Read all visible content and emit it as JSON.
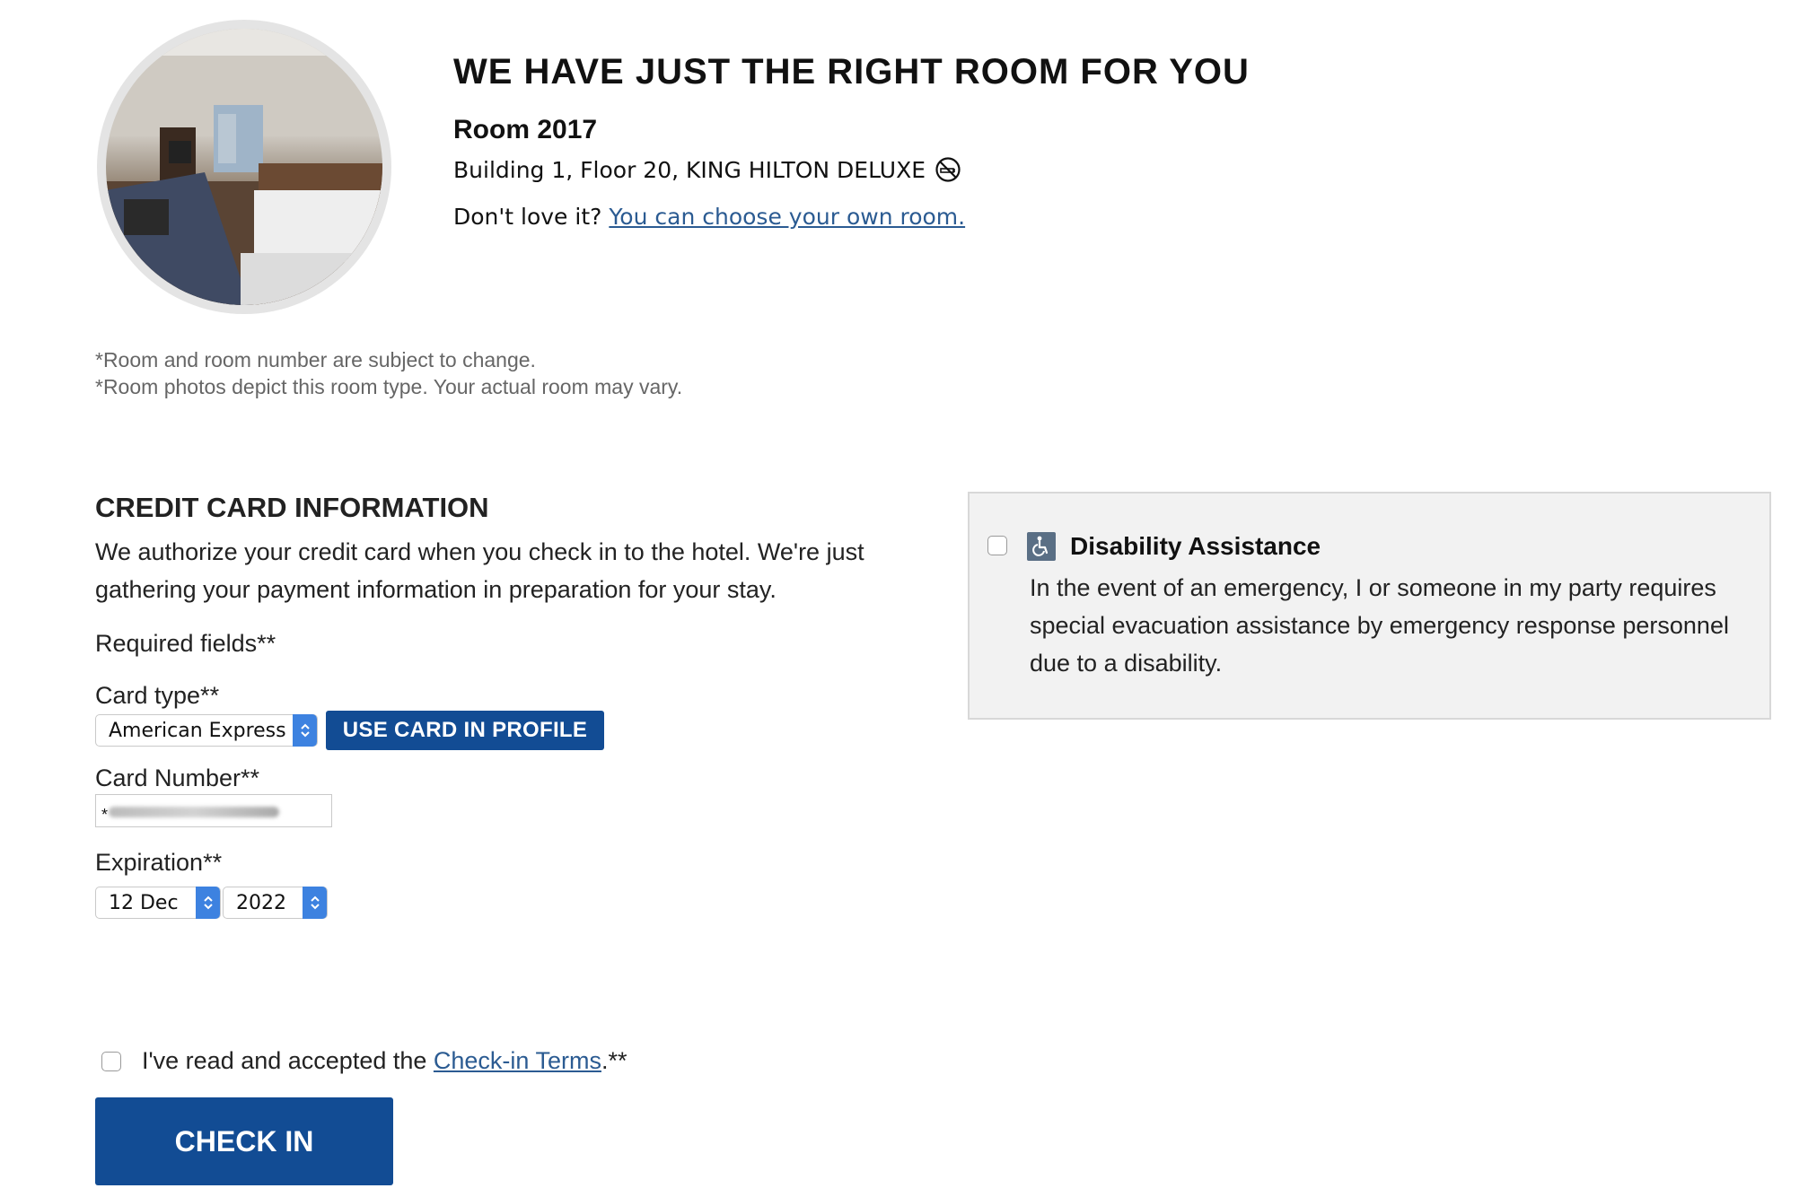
{
  "room": {
    "headline": "WE HAVE JUST THE RIGHT ROOM FOR YOU",
    "number": "Room 2017",
    "description": "Building 1, Floor 20, KING HILTON DELUXE",
    "smoking_icon": "no-smoking-icon",
    "dont_love_prefix": "Don't love it?",
    "choose_link": "You can choose your own room."
  },
  "notes": [
    "*Room and room number are subject to change.",
    "*Room photos depict this room type. Your actual room may vary."
  ],
  "credit_card": {
    "title": "CREDIT CARD INFORMATION",
    "description": "We authorize your credit card when you check in to the hotel. We're just gathering your payment information in preparation for your stay.",
    "required": "Required fields**",
    "card_type_label": "Card type**",
    "card_type_value": "American Express",
    "use_card_button": "USE CARD IN PROFILE",
    "card_number_label": "Card Number**",
    "card_number_value": "*",
    "expiration_label": "Expiration**",
    "exp_day": "12 Dec",
    "exp_year": "2022"
  },
  "terms": {
    "prefix": "I've read and accepted the ",
    "link": "Check-in Terms",
    "suffix": ".**"
  },
  "check_in_button": "CHECK IN",
  "disability": {
    "title": "Disability Assistance",
    "description": "In the event of an emergency, I or someone in my party requires special evacuation assistance by emergency response personnel due to a disability.",
    "icon": "wheelchair-icon"
  },
  "colors": {
    "primary_button": "#124c94",
    "link": "#2b5b92",
    "select_arrow": "#3d82e0",
    "panel_bg": "#f2f2f2"
  }
}
